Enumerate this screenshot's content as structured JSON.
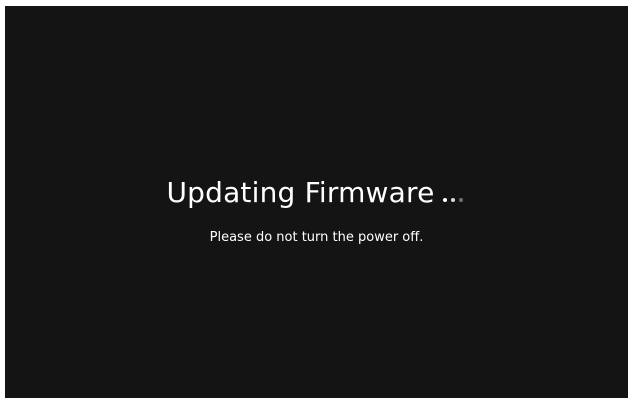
{
  "screen": {
    "title": "Updating Firmware",
    "message": "Please do not turn the power off.",
    "background_color": "#141414",
    "text_color": "#ffffff"
  },
  "progress_indicator": {
    "type": "loading-dots",
    "dots": [
      {
        "color": "#ffffff"
      },
      {
        "color": "#d8d8d8"
      },
      {
        "color": "#6e6e6e"
      }
    ]
  }
}
